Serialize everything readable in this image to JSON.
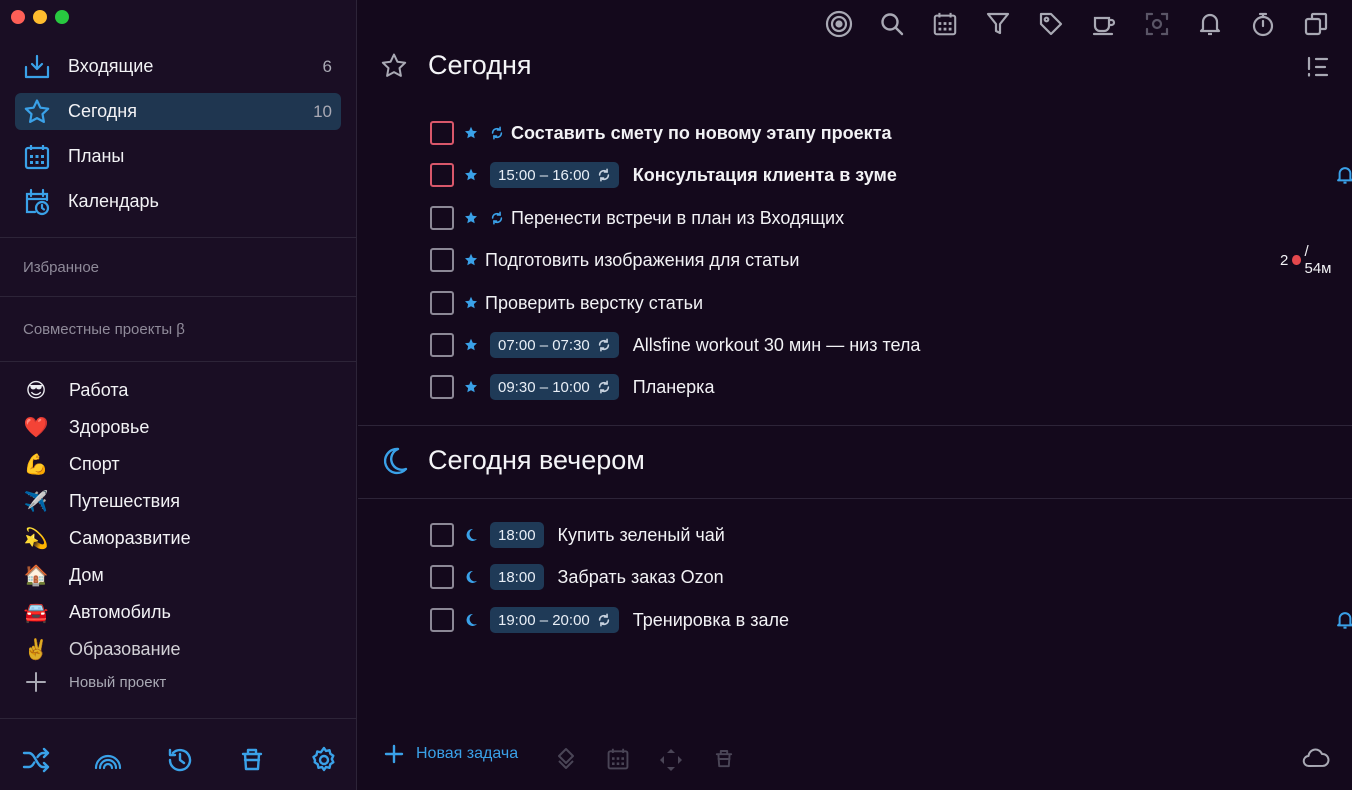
{
  "colors": {
    "accent": "#3aa1e8",
    "sidebar_bg": "#1a0e24",
    "main_bg": "#14091c",
    "active_bg": "#1f3650",
    "chip_bg": "#1f3a57",
    "priority_red": "#d9576a"
  },
  "sidebar": {
    "nav": [
      {
        "label": "Входящие",
        "count": "6",
        "icon": "inbox-icon"
      },
      {
        "label": "Сегодня",
        "count": "10",
        "icon": "star-icon",
        "active": true
      },
      {
        "label": "Планы",
        "count": "",
        "icon": "calendar-grid-icon"
      },
      {
        "label": "Календарь",
        "count": "",
        "icon": "calendar-clock-icon"
      }
    ],
    "favorites_title": "Избранное",
    "shared_title": "Совместные проекты β",
    "projects": [
      {
        "emoji": "😎",
        "label": "Работа"
      },
      {
        "emoji": "❤️",
        "label": "Здоровье"
      },
      {
        "emoji": "💪",
        "label": "Спорт"
      },
      {
        "emoji": "✈️",
        "label": "Путешествия"
      },
      {
        "emoji": "💫",
        "label": "Саморазвитие"
      },
      {
        "emoji": "🏠",
        "label": "Дом"
      },
      {
        "emoji": "🚘",
        "label": "Автомобиль"
      },
      {
        "emoji": "✌️",
        "label": "Образование"
      }
    ],
    "new_project": "Новый проект"
  },
  "today": {
    "title": "Сегодня",
    "tasks": [
      {
        "title": "Составить смету по новому этапу проекта",
        "time": "",
        "bold": true,
        "priority": true,
        "repeat": true
      },
      {
        "title": "Консультация клиента в зуме",
        "time": "15:00 – 16:00",
        "bold": true,
        "priority": true,
        "repeat": true,
        "bell": true
      },
      {
        "title": "Перенести встречи в план из Входящих",
        "time": "",
        "repeat": true
      },
      {
        "title": "Подготовить изображения для статьи",
        "time": "",
        "pomodoro_count": "2",
        "pomodoro_time": "/ 54м"
      },
      {
        "title": "Проверить верстку статьи",
        "time": ""
      },
      {
        "title": "Allsfine workout 30 мин — низ тела",
        "time": "07:00 – 07:30",
        "repeat_chip": true
      },
      {
        "title": "Планерка",
        "time": "09:30 – 10:00",
        "repeat_chip": true
      }
    ]
  },
  "evening": {
    "title": "Сегодня вечером",
    "tasks": [
      {
        "title": "Купить зеленый чай",
        "time": "18:00"
      },
      {
        "title": "Забрать заказ Ozon",
        "time": "18:00"
      },
      {
        "title": "Тренировка в зале",
        "time": "19:00 – 20:00",
        "repeat_chip": true,
        "bell": true
      }
    ]
  },
  "bottom": {
    "new_task": "Новая задача"
  }
}
